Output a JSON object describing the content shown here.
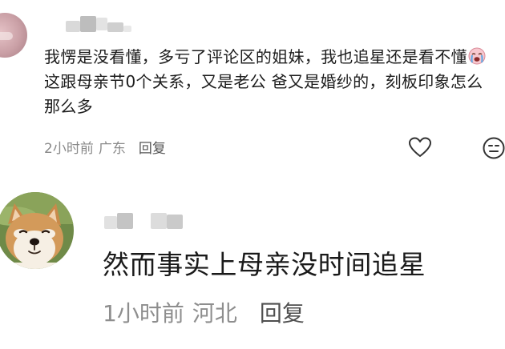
{
  "comments": [
    {
      "text_part1": "我愣是没看懂，多亏了评论区的姐妹，我也追星还是看不懂",
      "emoji": "crying-face-emoji",
      "text_part2": "这跟母亲节0个关系，又是老公 爸又是婚纱的，刻板印象怎么那么多",
      "time": "2小时前",
      "location": "广东",
      "reply_label": "回复",
      "avatar": "pink-blurred-avatar",
      "actions": [
        "heart-icon",
        "expressionless-face-icon"
      ]
    },
    {
      "text": "然而事实上母亲没时间追星",
      "time": "1小时前",
      "location": "河北",
      "reply_label": "回复",
      "avatar": "shiba-inu-dog-avatar"
    }
  ],
  "colors": {
    "text_primary": "#1c1c1c",
    "text_meta": "#8a8a8a",
    "reply": "#555555",
    "background": "#ffffff"
  }
}
